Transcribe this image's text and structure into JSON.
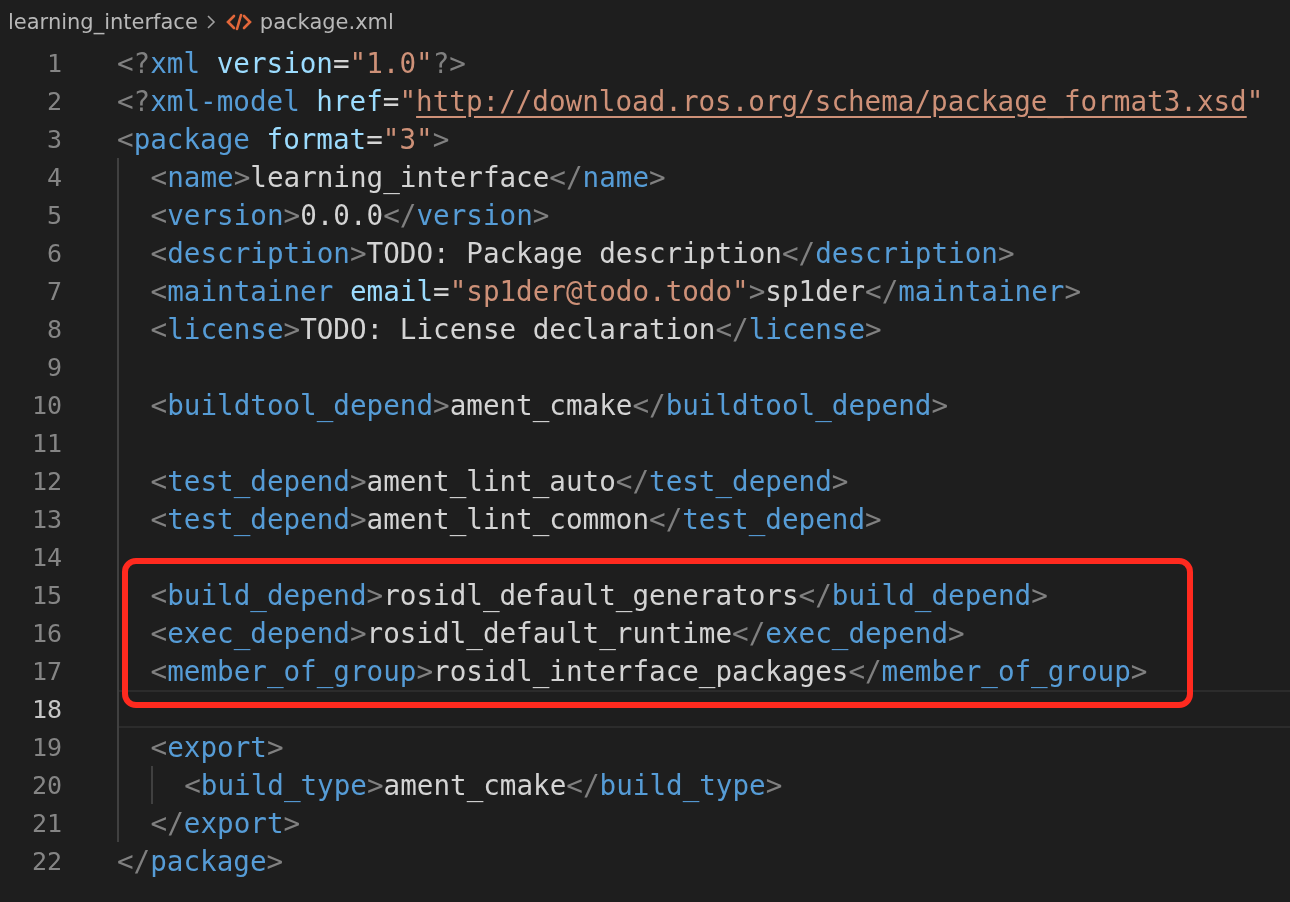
{
  "breadcrumb": {
    "folder": "learning_interface",
    "file": "package.xml"
  },
  "lines": [
    {
      "number": "1",
      "current": false,
      "highlighted": false,
      "tokens": [
        {
          "kind": "punct",
          "text": "<?"
        },
        {
          "kind": "tag",
          "text": "xml"
        },
        {
          "kind": "attr",
          "text": " version"
        },
        {
          "kind": "text",
          "text": "="
        },
        {
          "kind": "string",
          "text": "\"1.0\""
        },
        {
          "kind": "punct",
          "text": "?>"
        }
      ]
    },
    {
      "number": "2",
      "current": false,
      "highlighted": false,
      "tokens": [
        {
          "kind": "punct",
          "text": "<?"
        },
        {
          "kind": "tag",
          "text": "xml-model"
        },
        {
          "kind": "attr",
          "text": " href"
        },
        {
          "kind": "text",
          "text": "="
        },
        {
          "kind": "string",
          "text": "\""
        },
        {
          "kind": "link",
          "text": "http://download.ros.org/schema/package_format3.xsd"
        },
        {
          "kind": "string",
          "text": "\""
        }
      ]
    },
    {
      "number": "3",
      "current": false,
      "highlighted": false,
      "tokens": [
        {
          "kind": "punct",
          "text": "<"
        },
        {
          "kind": "tag",
          "text": "package"
        },
        {
          "kind": "attr",
          "text": " format"
        },
        {
          "kind": "text",
          "text": "="
        },
        {
          "kind": "string",
          "text": "\"3\""
        },
        {
          "kind": "punct",
          "text": ">"
        }
      ],
      "children": [
        {
          "number": "4",
          "current": false,
          "highlighted": false,
          "tokens": [
            {
              "kind": "punct",
              "text": "<"
            },
            {
              "kind": "tag",
              "text": "name"
            },
            {
              "kind": "punct",
              "text": ">"
            },
            {
              "kind": "text",
              "text": "learning_interface"
            },
            {
              "kind": "punct",
              "text": "</"
            },
            {
              "kind": "tag",
              "text": "name"
            },
            {
              "kind": "punct",
              "text": ">"
            }
          ]
        },
        {
          "number": "5",
          "current": false,
          "highlighted": false,
          "tokens": [
            {
              "kind": "punct",
              "text": "<"
            },
            {
              "kind": "tag",
              "text": "version"
            },
            {
              "kind": "punct",
              "text": ">"
            },
            {
              "kind": "text",
              "text": "0.0.0"
            },
            {
              "kind": "punct",
              "text": "</"
            },
            {
              "kind": "tag",
              "text": "version"
            },
            {
              "kind": "punct",
              "text": ">"
            }
          ]
        },
        {
          "number": "6",
          "current": false,
          "highlighted": false,
          "tokens": [
            {
              "kind": "punct",
              "text": "<"
            },
            {
              "kind": "tag",
              "text": "description"
            },
            {
              "kind": "punct",
              "text": ">"
            },
            {
              "kind": "text",
              "text": "TODO: Package description"
            },
            {
              "kind": "punct",
              "text": "</"
            },
            {
              "kind": "tag",
              "text": "description"
            },
            {
              "kind": "punct",
              "text": ">"
            }
          ]
        },
        {
          "number": "7",
          "current": false,
          "highlighted": false,
          "tokens": [
            {
              "kind": "punct",
              "text": "<"
            },
            {
              "kind": "tag",
              "text": "maintainer"
            },
            {
              "kind": "attr",
              "text": " email"
            },
            {
              "kind": "text",
              "text": "="
            },
            {
              "kind": "string",
              "text": "\"sp1der@todo.todo\""
            },
            {
              "kind": "punct",
              "text": ">"
            },
            {
              "kind": "text",
              "text": "sp1der"
            },
            {
              "kind": "punct",
              "text": "</"
            },
            {
              "kind": "tag",
              "text": "maintainer"
            },
            {
              "kind": "punct",
              "text": ">"
            }
          ]
        },
        {
          "number": "8",
          "current": false,
          "highlighted": false,
          "tokens": [
            {
              "kind": "punct",
              "text": "<"
            },
            {
              "kind": "tag",
              "text": "license"
            },
            {
              "kind": "punct",
              "text": ">"
            },
            {
              "kind": "text",
              "text": "TODO: License declaration"
            },
            {
              "kind": "punct",
              "text": "</"
            },
            {
              "kind": "tag",
              "text": "license"
            },
            {
              "kind": "punct",
              "text": ">"
            }
          ]
        },
        {
          "number": "9",
          "current": false,
          "highlighted": false
        },
        {
          "number": "10",
          "current": false,
          "highlighted": false,
          "tokens": [
            {
              "kind": "punct",
              "text": "<"
            },
            {
              "kind": "tag",
              "text": "buildtool_depend"
            },
            {
              "kind": "punct",
              "text": ">"
            },
            {
              "kind": "text",
              "text": "ament_cmake"
            },
            {
              "kind": "punct",
              "text": "</"
            },
            {
              "kind": "tag",
              "text": "buildtool_depend"
            },
            {
              "kind": "punct",
              "text": ">"
            }
          ]
        },
        {
          "number": "11",
          "current": false,
          "highlighted": false
        },
        {
          "number": "12",
          "current": false,
          "highlighted": false,
          "tokens": [
            {
              "kind": "punct",
              "text": "<"
            },
            {
              "kind": "tag",
              "text": "test_depend"
            },
            {
              "kind": "punct",
              "text": ">"
            },
            {
              "kind": "text",
              "text": "ament_lint_auto"
            },
            {
              "kind": "punct",
              "text": "</"
            },
            {
              "kind": "tag",
              "text": "test_depend"
            },
            {
              "kind": "punct",
              "text": ">"
            }
          ]
        },
        {
          "number": "13",
          "current": false,
          "highlighted": false,
          "tokens": [
            {
              "kind": "punct",
              "text": "<"
            },
            {
              "kind": "tag",
              "text": "test_depend"
            },
            {
              "kind": "punct",
              "text": ">"
            },
            {
              "kind": "text",
              "text": "ament_lint_common"
            },
            {
              "kind": "punct",
              "text": "</"
            },
            {
              "kind": "tag",
              "text": "test_depend"
            },
            {
              "kind": "punct",
              "text": ">"
            }
          ]
        },
        {
          "number": "14",
          "current": false,
          "highlighted": false
        },
        {
          "number": "15",
          "current": false,
          "highlighted": true,
          "tokens": [
            {
              "kind": "punct",
              "text": "<"
            },
            {
              "kind": "tag",
              "text": "build_depend"
            },
            {
              "kind": "punct",
              "text": ">"
            },
            {
              "kind": "text",
              "text": "rosidl_default_generators"
            },
            {
              "kind": "punct",
              "text": "</"
            },
            {
              "kind": "tag",
              "text": "build_depend"
            },
            {
              "kind": "punct",
              "text": ">"
            }
          ]
        },
        {
          "number": "16",
          "current": false,
          "highlighted": true,
          "tokens": [
            {
              "kind": "punct",
              "text": "<"
            },
            {
              "kind": "tag",
              "text": "exec_depend"
            },
            {
              "kind": "punct",
              "text": ">"
            },
            {
              "kind": "text",
              "text": "rosidl_default_runtime"
            },
            {
              "kind": "punct",
              "text": "</"
            },
            {
              "kind": "tag",
              "text": "exec_depend"
            },
            {
              "kind": "punct",
              "text": ">"
            }
          ]
        },
        {
          "number": "17",
          "current": false,
          "highlighted": true,
          "tokens": [
            {
              "kind": "punct",
              "text": "<"
            },
            {
              "kind": "tag",
              "text": "member_of_group"
            },
            {
              "kind": "punct",
              "text": ">"
            },
            {
              "kind": "text",
              "text": "rosidl_interface_packages"
            },
            {
              "kind": "punct",
              "text": "</"
            },
            {
              "kind": "tag",
              "text": "member_of_group"
            },
            {
              "kind": "punct",
              "text": ">"
            }
          ]
        },
        {
          "number": "18",
          "current": true,
          "highlighted": false
        },
        {
          "number": "19",
          "current": false,
          "highlighted": false,
          "tokens": [
            {
              "kind": "punct",
              "text": "<"
            },
            {
              "kind": "tag",
              "text": "export"
            },
            {
              "kind": "punct",
              "text": ">"
            }
          ],
          "children": [
            {
              "number": "20",
              "current": false,
              "highlighted": false,
              "tokens": [
                {
                  "kind": "punct",
                  "text": "<"
                },
                {
                  "kind": "tag",
                  "text": "build_type"
                },
                {
                  "kind": "punct",
                  "text": ">"
                },
                {
                  "kind": "text",
                  "text": "ament_cmake"
                },
                {
                  "kind": "punct",
                  "text": "</"
                },
                {
                  "kind": "tag",
                  "text": "build_type"
                },
                {
                  "kind": "punct",
                  "text": ">"
                }
              ]
            }
          ]
        },
        {
          "number": "21",
          "current": false,
          "highlighted": false,
          "tokens": [
            {
              "kind": "punct",
              "text": "</"
            },
            {
              "kind": "tag",
              "text": "export"
            },
            {
              "kind": "punct",
              "text": ">"
            }
          ]
        }
      ]
    },
    {
      "number": "22",
      "current": false,
      "highlighted": false,
      "tokens": [
        {
          "kind": "punct",
          "text": "</"
        },
        {
          "kind": "tag",
          "text": "package"
        },
        {
          "kind": "punct",
          "text": ">"
        }
      ]
    }
  ]
}
